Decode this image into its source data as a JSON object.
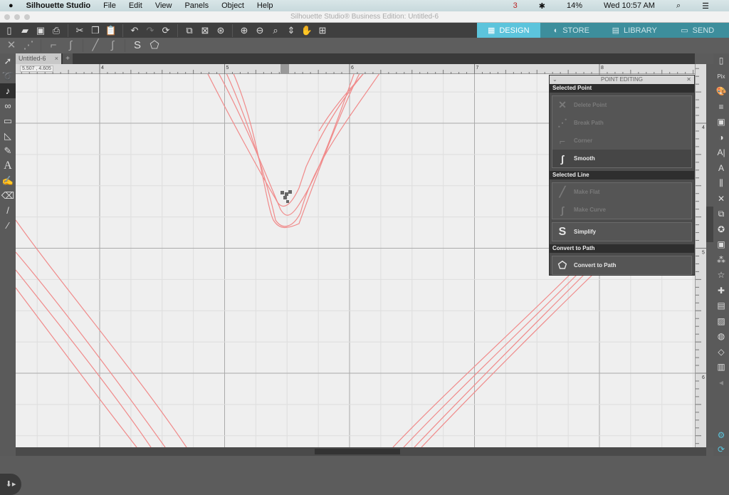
{
  "menubar": {
    "app": "Silhouette Studio",
    "items": [
      "File",
      "Edit",
      "View",
      "Panels",
      "Object",
      "Help"
    ],
    "status": {
      "notif": "3",
      "battery": "14%",
      "clock": "Wed 10:57 AM"
    }
  },
  "window": {
    "title": "Silhouette Studio® Business Edition: Untitled-6"
  },
  "nav": {
    "tabs": [
      {
        "label": "DESIGN",
        "icon": "grid-icon",
        "active": true
      },
      {
        "label": "STORE",
        "icon": "store-icon"
      },
      {
        "label": "LIBRARY",
        "icon": "library-icon"
      },
      {
        "label": "SEND",
        "icon": "send-icon"
      }
    ]
  },
  "document": {
    "tab": "Untitled-6",
    "close": "×",
    "add": "+",
    "coords": "5.507 , 4.605"
  },
  "rulers": {
    "h": [
      "4",
      "5",
      "6",
      "7",
      "8"
    ],
    "v": [
      "4",
      "5",
      "6"
    ]
  },
  "panel": {
    "title": "POINT EDITING",
    "sections": {
      "point": "Selected Point",
      "line": "Selected Line",
      "path": "Convert to Path"
    },
    "buttons": {
      "delete": "Delete Point",
      "break": "Break Path",
      "corner": "Corner",
      "smooth": "Smooth",
      "flat": "Make Flat",
      "curve": "Make Curve",
      "simplify": "Simplify",
      "convert": "Convert to Path"
    }
  },
  "colors": {
    "accent": "#5cc4dc",
    "cut_line": "#f08080"
  }
}
